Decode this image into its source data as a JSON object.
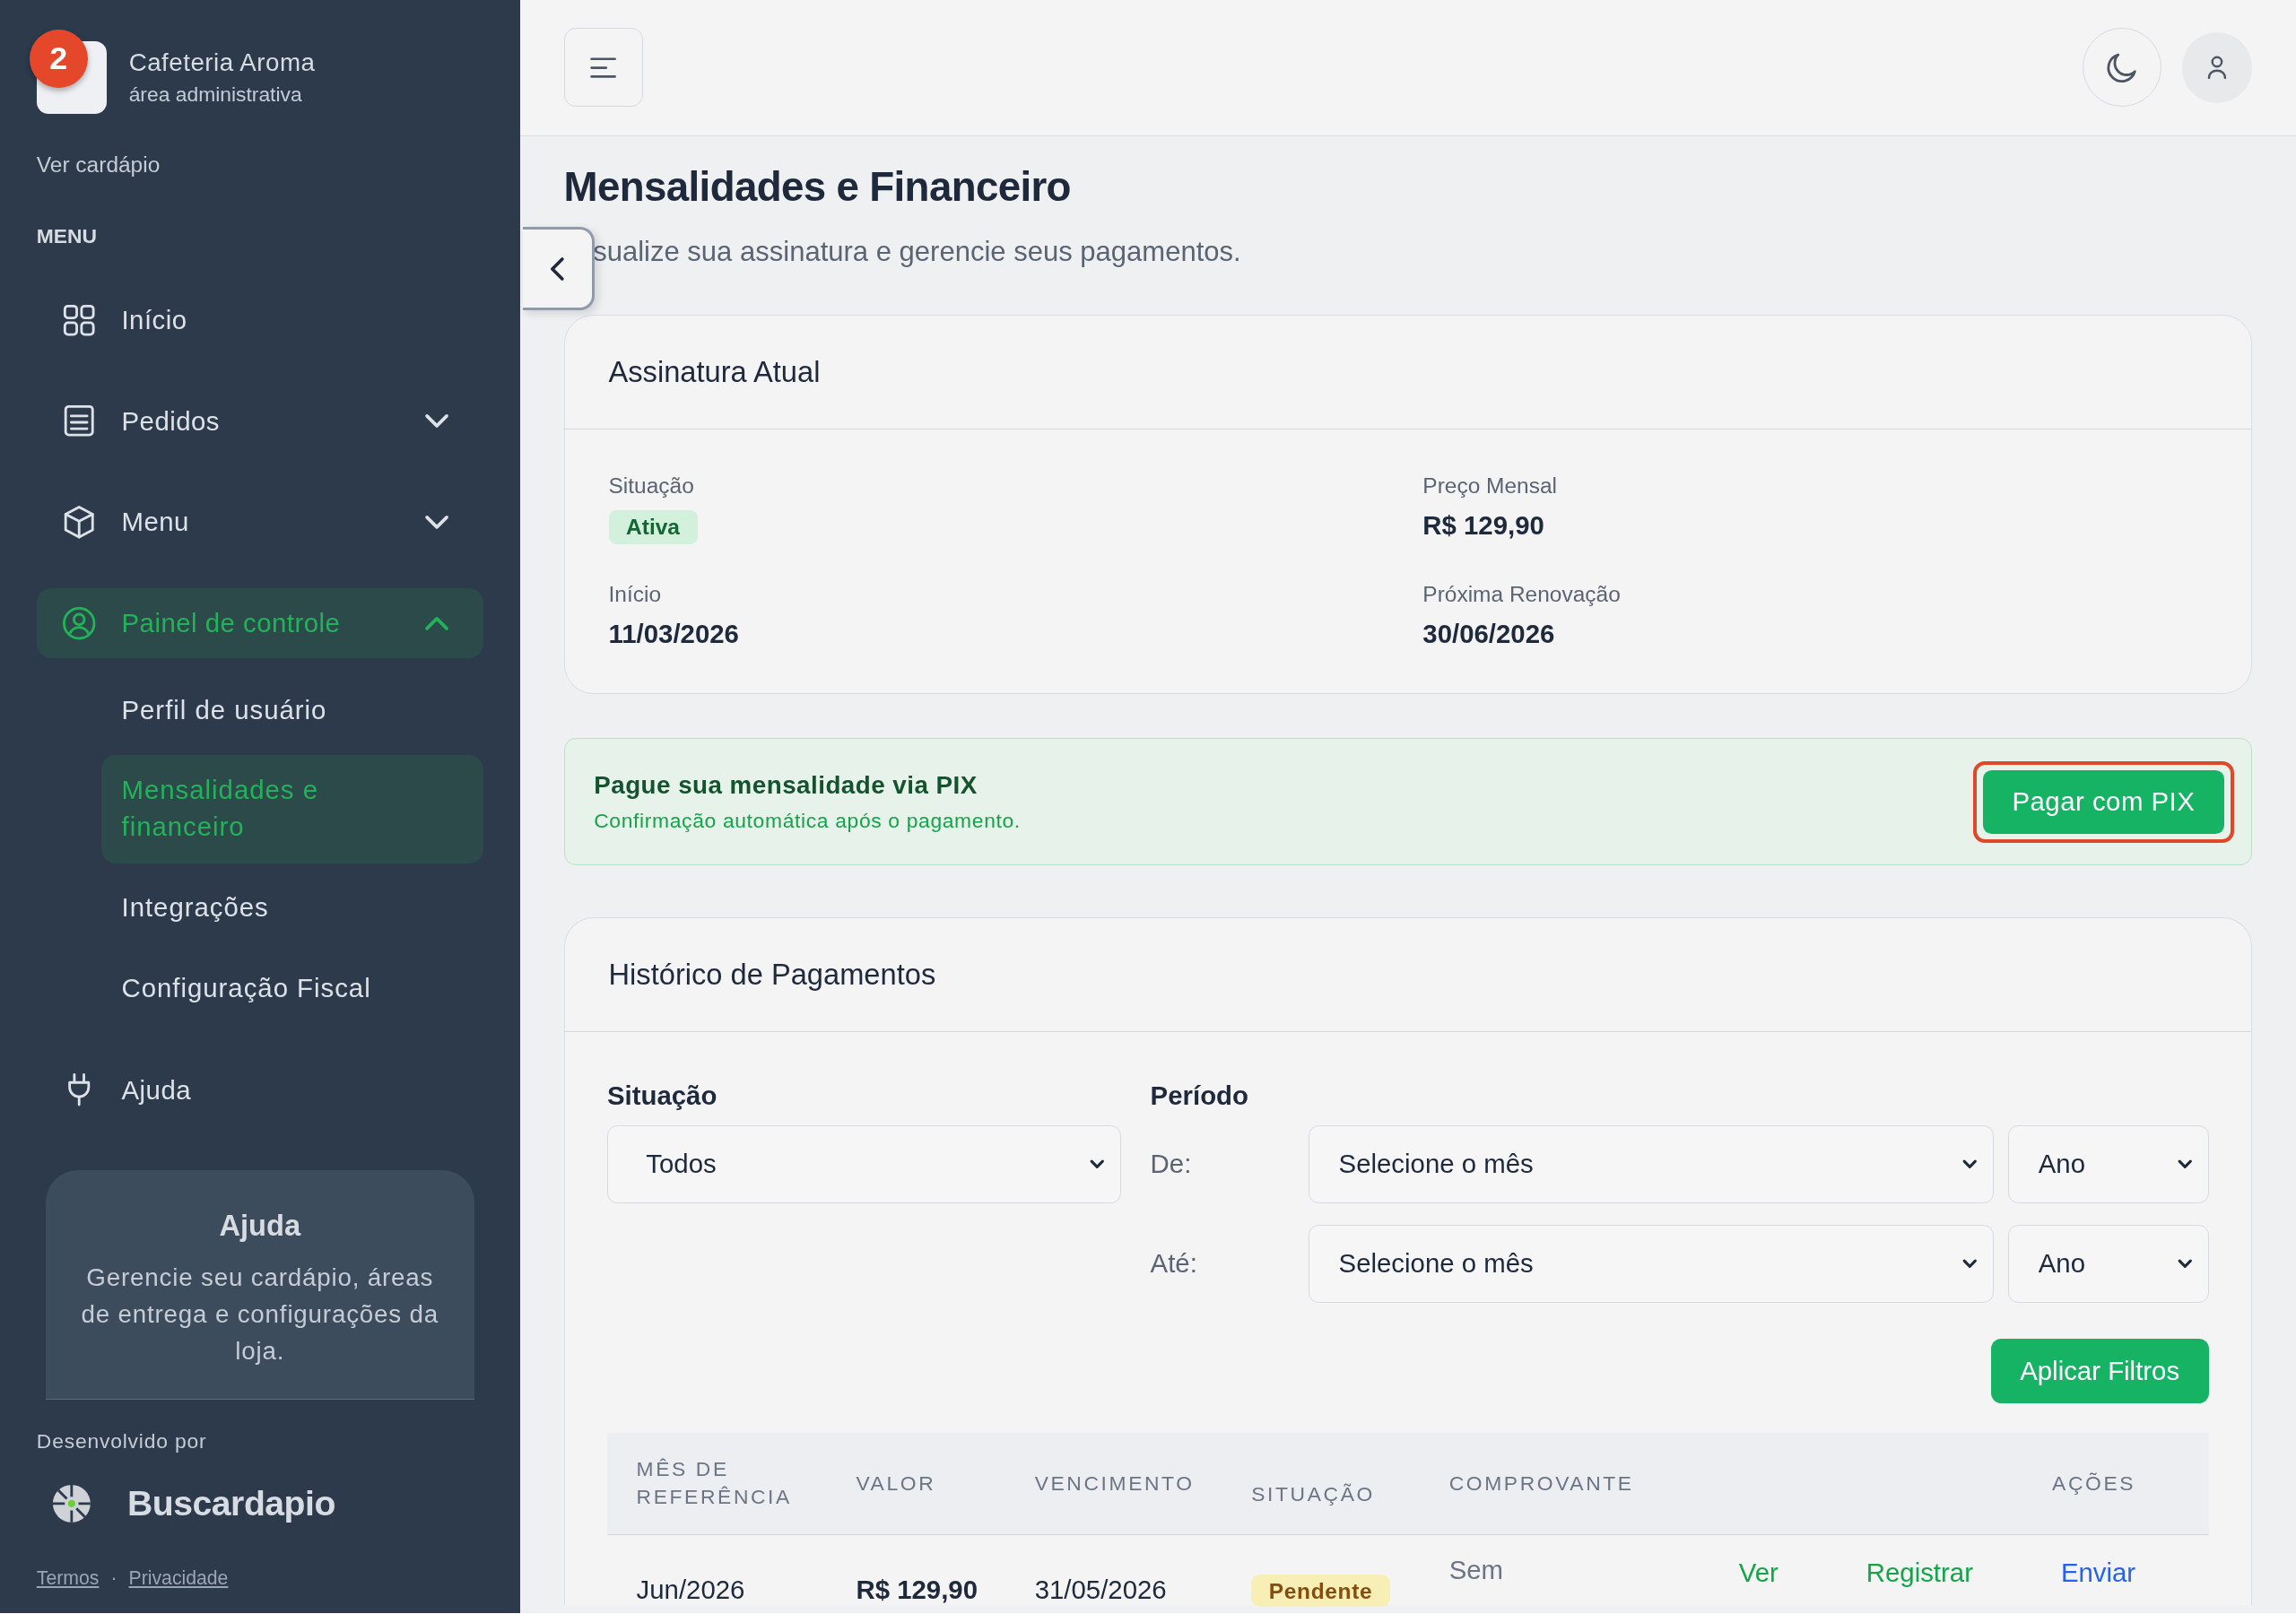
{
  "sidebar": {
    "badge": "2",
    "brand": "Cafeteria Aroma",
    "subtitle": "área administrativa",
    "view_menu_link": "Ver cardápio",
    "section_label": "MENU",
    "items": [
      {
        "label": "Início",
        "selected": false
      },
      {
        "label": "Pedidos",
        "selected": false,
        "expanded": false
      },
      {
        "label": "Menu",
        "selected": false,
        "expanded": false
      },
      {
        "label": "Painel de controle",
        "selected": true,
        "expanded": true,
        "children": [
          {
            "label": "Perfil de usuário",
            "selected": false
          },
          {
            "label": "Mensalidades e financeiro",
            "selected": true
          },
          {
            "label": "Integrações",
            "selected": false
          },
          {
            "label": "Configuração Fiscal",
            "selected": false
          }
        ]
      },
      {
        "label": "Ajuda",
        "selected": false
      }
    ],
    "help_card": {
      "title": "Ajuda",
      "text": "Gerencie seu cardápio, áreas de entrega e configurações da loja."
    },
    "credit": "Desenvolvido por",
    "maker": "Buscardapio",
    "links": [
      "Termos",
      "Privacidade"
    ],
    "separator": "·"
  },
  "page": {
    "title": "Mensalidades e Financeiro",
    "subtitle": "sualize sua assinatura e gerencie seus pagamentos."
  },
  "subscription": {
    "title": "Assinatura Atual",
    "fields": [
      {
        "label": "Situação",
        "value": "Ativa",
        "kind": "badge"
      },
      {
        "label": "Preço Mensal",
        "value": "R$ 129,90",
        "kind": "text"
      },
      {
        "label": "Início",
        "value": "11/03/2026",
        "kind": "text"
      },
      {
        "label": "Próxima Renovação",
        "value": "30/06/2026",
        "kind": "text"
      }
    ]
  },
  "pix": {
    "title": "Pague sua mensalidade via PIX",
    "text": "Confirmação automática após o pagamento.",
    "button": "Pagar com PIX",
    "highlighted": true
  },
  "history": {
    "title": "Histórico de Pagamentos",
    "filters": {
      "status_label": "Situação",
      "status_value": "Todos",
      "period_label": "Período",
      "ranges": [
        {
          "label": "De:",
          "month": "Selecione o mês",
          "year": "Ano"
        },
        {
          "label": "Até:",
          "month": "Selecione o mês",
          "year": "Ano"
        }
      ],
      "apply": "Aplicar Filtros"
    },
    "table": {
      "columns": [
        "MÊS DE REFERÊNCIA",
        "VALOR",
        "VENCIMENTO",
        "SITUAÇÃO",
        "COMPROVANTE",
        "AÇÕES"
      ],
      "rows": [
        {
          "month": "Jun/2026",
          "value": "R$ 129,90",
          "due": "31/05/2026",
          "status": "Pendente",
          "receipt": "Sem",
          "actions": [
            {
              "label": "Ver",
              "kind": "view"
            },
            {
              "label": "Registrar",
              "kind": "register"
            },
            {
              "label": "Enviar",
              "kind": "upload"
            }
          ]
        }
      ]
    }
  }
}
